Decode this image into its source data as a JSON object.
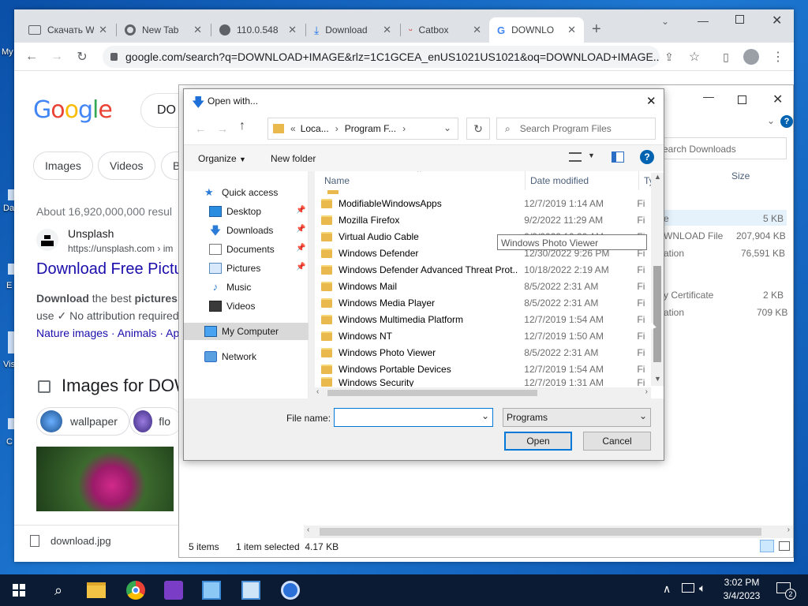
{
  "desktop": {
    "icon_labels": [
      "My",
      "Da",
      "E",
      "Vis",
      "C"
    ]
  },
  "browser": {
    "tabs": [
      {
        "label": "Скачать W",
        "icon": "doc-icon"
      },
      {
        "label": "New Tab",
        "icon": "chrome-icon"
      },
      {
        "label": "110.0.548",
        "icon": "globe-icon"
      },
      {
        "label": "Download",
        "icon": "download-arrow-icon"
      },
      {
        "label": "Catbox",
        "icon": "catbox-icon"
      },
      {
        "label": "DOWNLO",
        "icon": "google-g-icon"
      }
    ],
    "url": "google.com/search?q=DOWNLOAD+IMAGE&rlz=1C1GCEA_enUS1021US1021&oq=DOWNLOAD+IMAGE...",
    "google": {
      "logo": "Google",
      "search_partial": "DO",
      "chips": [
        "Images",
        "Videos",
        "B"
      ],
      "about": "About 16,920,000,000 resul",
      "result": {
        "site": "Unsplash",
        "url": "https://unsplash.com › im",
        "title": "Download Free Pictu",
        "snippet_bold1": "Download",
        "snippet1": " the best ",
        "snippet_bold2": "pictures",
        "snippet_end": ".",
        "snippet2": "use ✓ No attribution required",
        "links": "Nature images · Animals · Ap"
      },
      "images_header": "Images for DOW",
      "image_chips": [
        "wallpaper",
        "flo"
      ]
    },
    "download_bar": {
      "file": "download.jpg"
    }
  },
  "explorer": {
    "search_placeholder": "earch Downloads",
    "size_header": "Size",
    "rows": [
      {
        "type": "e",
        "size": "5 KB"
      },
      {
        "type": "WNLOAD File",
        "size": "207,904 KB"
      },
      {
        "type": "ation",
        "size": "76,591 KB"
      },
      {
        "type": "y Certificate",
        "size": "2 KB"
      },
      {
        "type": "ation",
        "size": "709 KB"
      }
    ],
    "status_items": "5 items",
    "status_selected": "1 item selected  4.17 KB"
  },
  "dialog": {
    "title": "Open with...",
    "breadcrumb": [
      "Loca...",
      "Program F..."
    ],
    "search_placeholder": "Search Program Files",
    "organize": "Organize",
    "new_folder": "New folder",
    "nav": {
      "quick_access": "Quick access",
      "items": [
        {
          "label": "Desktop",
          "pinned": true
        },
        {
          "label": "Downloads",
          "pinned": true
        },
        {
          "label": "Documents",
          "pinned": true
        },
        {
          "label": "Pictures",
          "pinned": true
        },
        {
          "label": "Music",
          "pinned": false
        },
        {
          "label": "Videos",
          "pinned": false
        }
      ],
      "my_computer": "My Computer",
      "network": "Network"
    },
    "columns": {
      "name": "Name",
      "date": "Date modified",
      "type": "Ty"
    },
    "files": [
      {
        "name": "ModifiableWindowsApps",
        "date": "12/7/2019 1:14 AM",
        "type": "Fi"
      },
      {
        "name": "Mozilla Firefox",
        "date": "9/2/2022 11:29 AM",
        "type": "Fi"
      },
      {
        "name": "Virtual Audio Cable",
        "date": "9/3/2022 10:20 AM",
        "type": "Fi"
      },
      {
        "name": "Windows Defender",
        "date": "12/30/2022 9:26 PM",
        "type": "Fi"
      },
      {
        "name": "Windows Defender Advanced Threat Prot...",
        "date": "10/18/2022 2:19 AM",
        "type": "Fi"
      },
      {
        "name": "Windows Mail",
        "date": "8/5/2022 2:31 AM",
        "type": "Fi"
      },
      {
        "name": "Windows Media Player",
        "date": "8/5/2022 2:31 AM",
        "type": "Fi"
      },
      {
        "name": "Windows Multimedia Platform",
        "date": "12/7/2019 1:54 AM",
        "type": "Fi"
      },
      {
        "name": "Windows NT",
        "date": "12/7/2019 1:50 AM",
        "type": "Fi"
      },
      {
        "name": "Windows Photo Viewer",
        "date": "8/5/2022 2:31 AM",
        "type": "Fi"
      },
      {
        "name": "Windows Portable Devices",
        "date": "12/7/2019 1:54 AM",
        "type": "Fi"
      },
      {
        "name": "Windows Security",
        "date": "12/7/2019 1:31 AM",
        "type": "Fi"
      }
    ],
    "tooltip": "Windows Photo Viewer",
    "file_name_label": "File name:",
    "file_name_value": "",
    "filter": "Programs",
    "open": "Open",
    "cancel": "Cancel"
  },
  "taskbar": {
    "time": "3:02 PM",
    "date": "3/4/2023",
    "notification_count": "2"
  },
  "colors": {
    "accent": "#0078d7",
    "google_link": "#1a0dab",
    "taskbar": "#0b1b33"
  }
}
